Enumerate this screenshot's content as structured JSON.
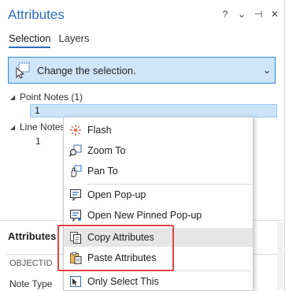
{
  "pane": {
    "title": "Attributes",
    "controls": [
      "?",
      "⌄",
      "⊣",
      "✕"
    ]
  },
  "tabs": [
    {
      "label": "Selection",
      "active": true
    },
    {
      "label": "Layers",
      "active": false
    }
  ],
  "selection_bar": {
    "text": "Change the selection.",
    "icon": "selection-cursor-icon"
  },
  "tree": {
    "group1": {
      "label": "Point Notes (1)"
    },
    "group1_item": "1",
    "group2": {
      "label": "Line Notes"
    },
    "group2_item": "1"
  },
  "attributes_section": {
    "heading": "Attributes",
    "column_header": "OBJECTID",
    "row_label": "Note Type"
  },
  "context_menu": {
    "items": [
      {
        "label": "Flash",
        "icon": "flash-icon"
      },
      {
        "label": "Zoom To",
        "icon": "zoom-to-icon"
      },
      {
        "label": "Pan To",
        "icon": "pan-hand-icon"
      },
      {
        "label": "Open Pop-up",
        "icon": "popup-icon"
      },
      {
        "label": "Open New Pinned Pop-up",
        "icon": "pinned-popup-icon"
      },
      {
        "label": "Copy Attributes",
        "icon": "copy-icon"
      },
      {
        "label": "Paste Attributes",
        "icon": "paste-icon"
      },
      {
        "label": "Only Select This",
        "icon": "select-only-icon"
      }
    ]
  },
  "colors": {
    "accent": "#2c6fbf",
    "highlight_box": "#e04545"
  }
}
